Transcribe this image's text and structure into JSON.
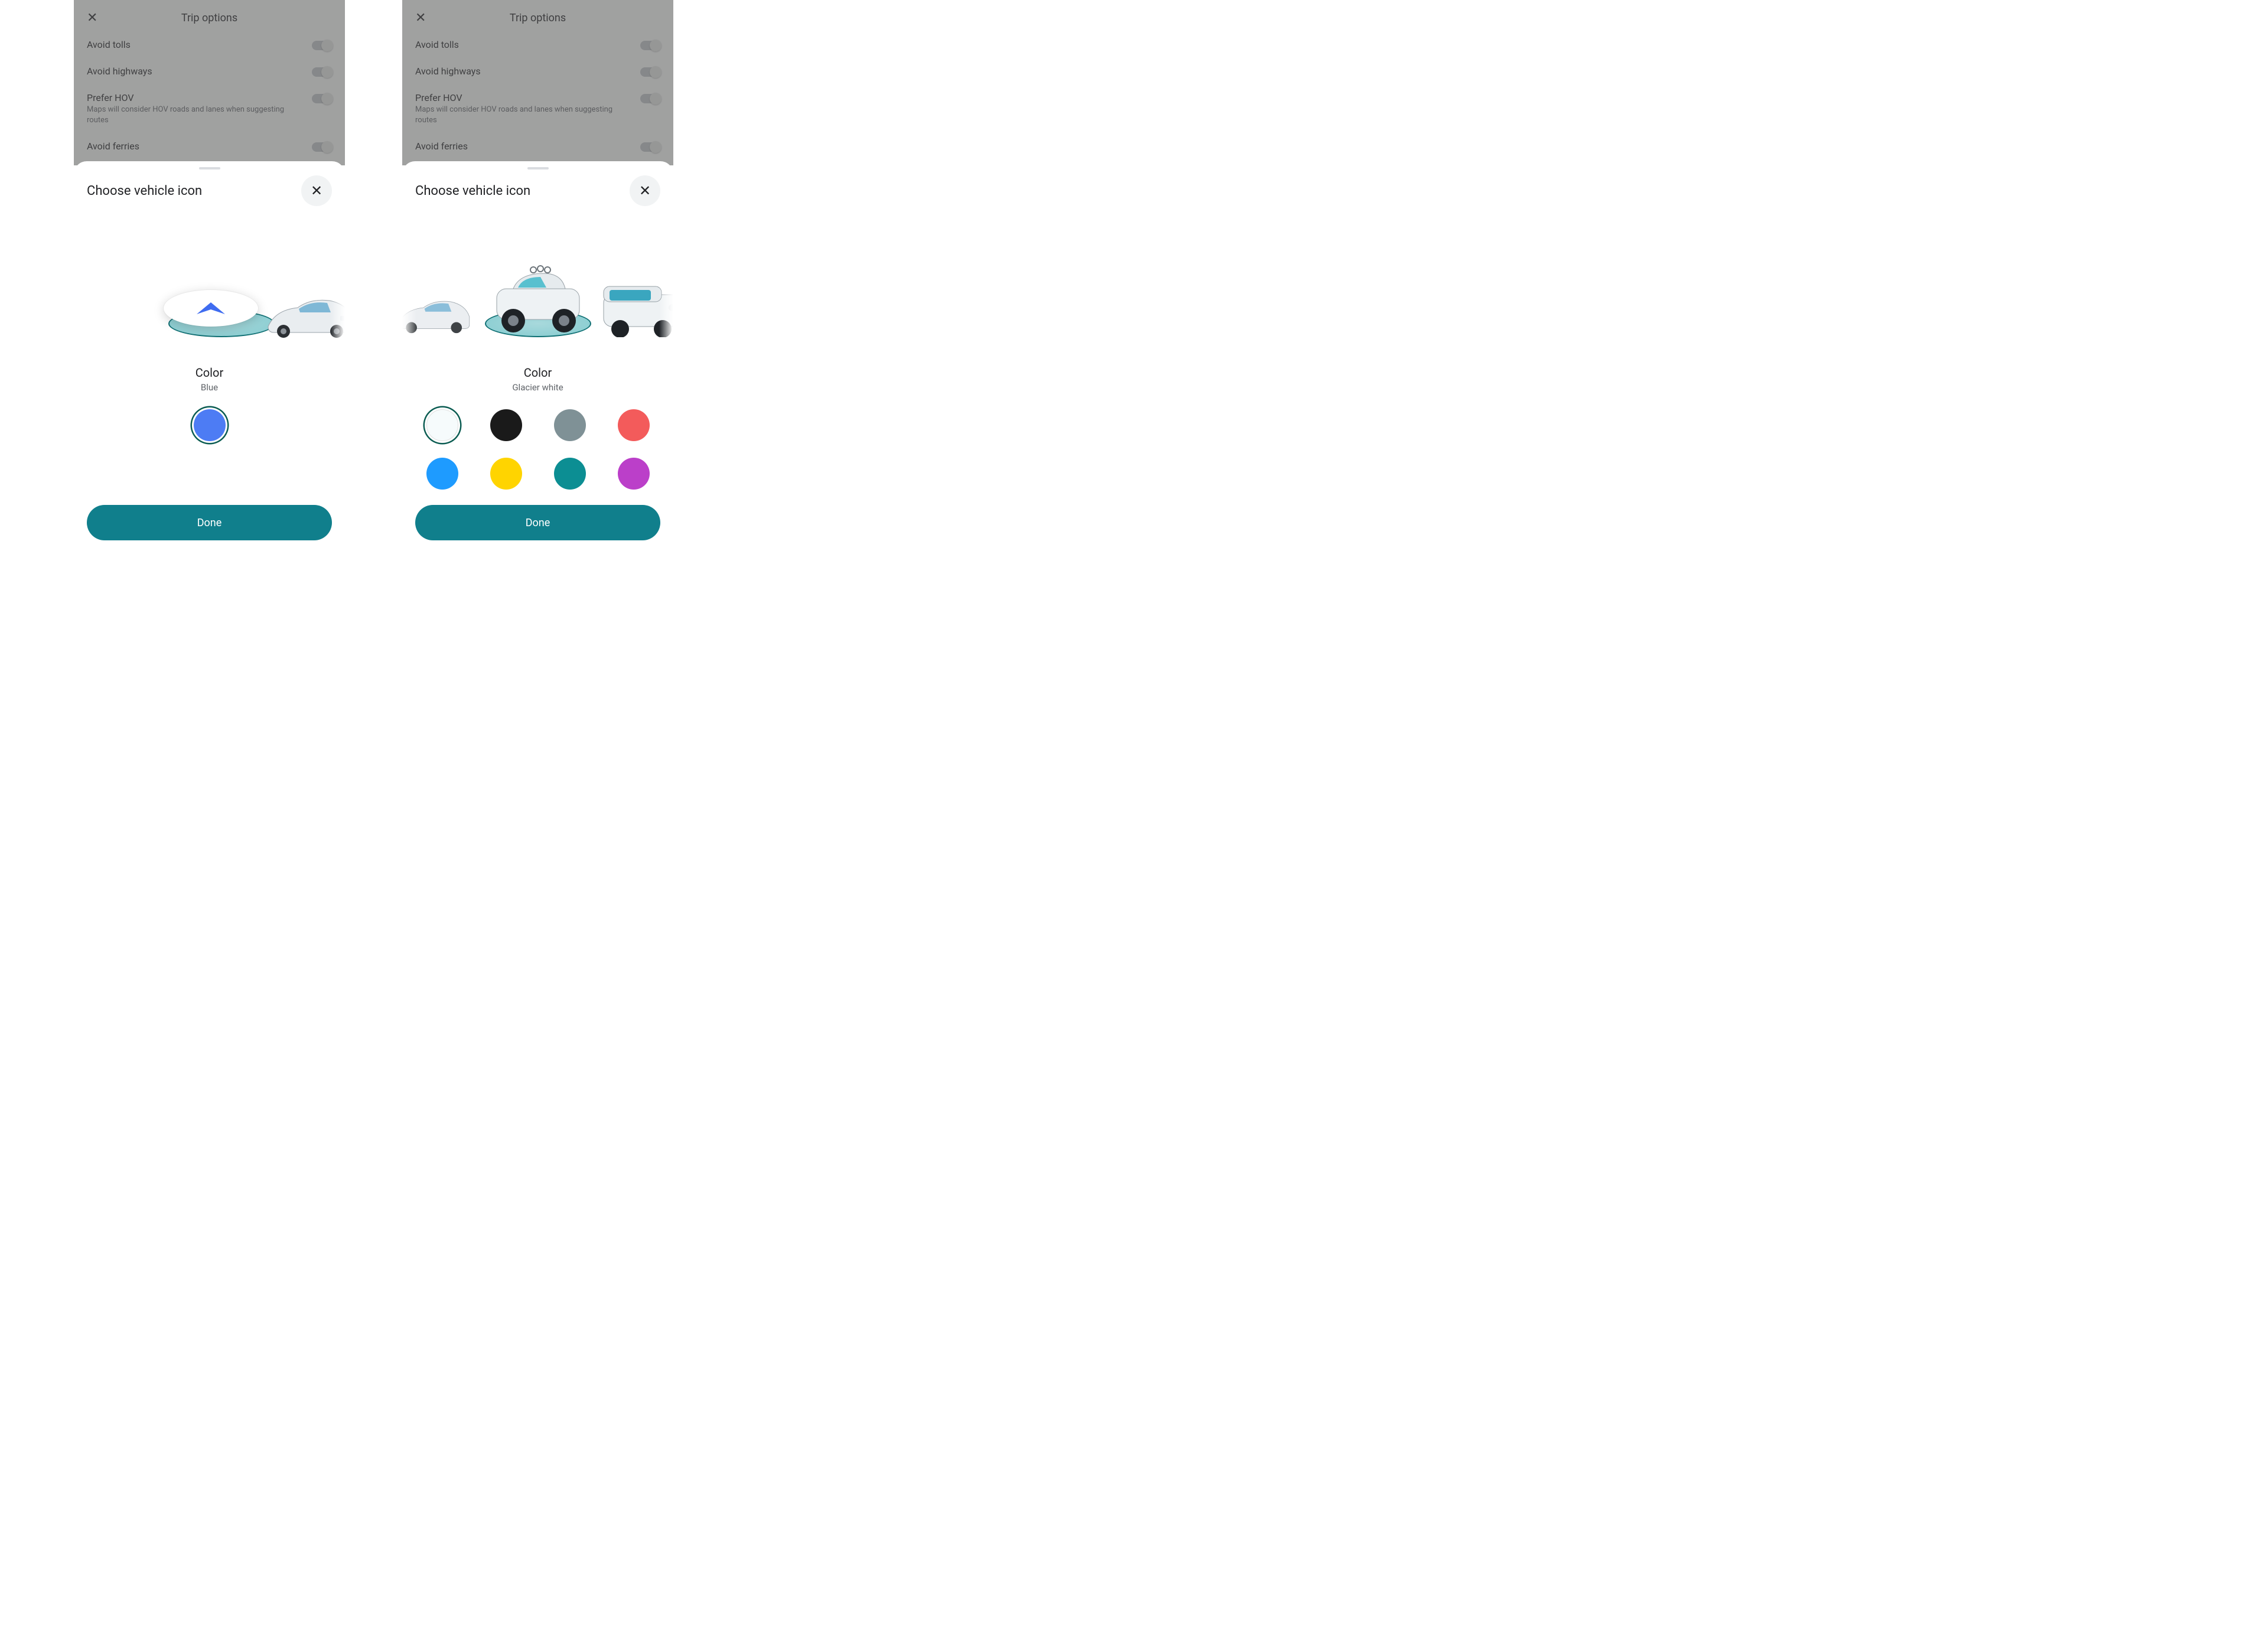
{
  "trip_options": {
    "title": "Trip options",
    "rows": [
      {
        "label": "Avoid tolls"
      },
      {
        "label": "Avoid highways"
      },
      {
        "label": "Prefer HOV",
        "sub": "Maps will consider HOV roads and lanes when suggesting routes"
      },
      {
        "label": "Avoid ferries"
      }
    ]
  },
  "sheet": {
    "title": "Choose vehicle icon",
    "color_heading": "Color",
    "done": "Done"
  },
  "left": {
    "selected_color_name": "Blue",
    "swatches": [
      {
        "name": "blue",
        "hex": "#4d7cf4",
        "selected": true
      }
    ]
  },
  "right": {
    "selected_color_name": "Glacier white",
    "swatches": [
      {
        "name": "glacier-white",
        "hex": "#f6fbfc",
        "selected": true,
        "whiteish": true
      },
      {
        "name": "black",
        "hex": "#1a1a1a"
      },
      {
        "name": "grey",
        "hex": "#7f9196"
      },
      {
        "name": "red",
        "hex": "#f35b5b"
      },
      {
        "name": "sky-blue",
        "hex": "#1e9bff"
      },
      {
        "name": "yellow",
        "hex": "#ffd400"
      },
      {
        "name": "teal",
        "hex": "#0c8e93"
      },
      {
        "name": "magenta",
        "hex": "#bb3fc9"
      }
    ]
  }
}
